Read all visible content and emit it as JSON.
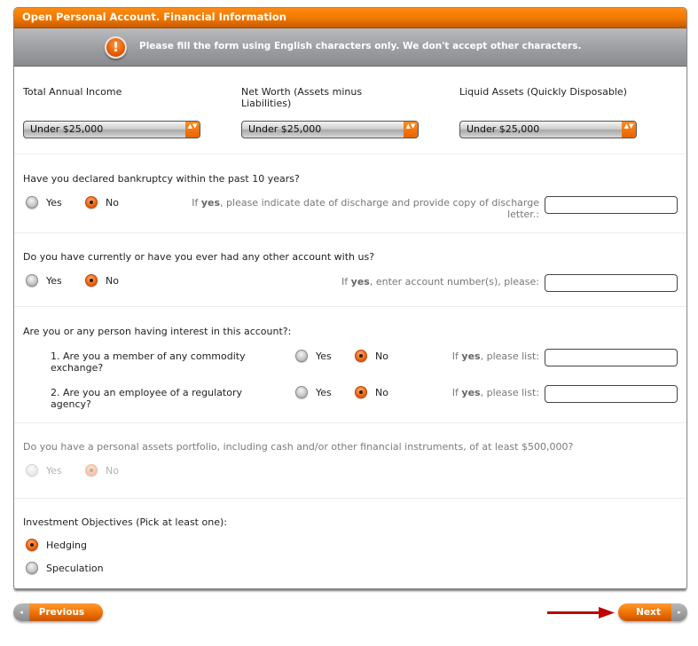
{
  "header": {
    "title": "Open Personal Account. Financial Information"
  },
  "notice": {
    "icon": "exclamation-icon",
    "icon_glyph": "!",
    "text": "Please fill the form using English characters only. We don't accept other characters."
  },
  "financials": {
    "total_annual_income": {
      "label": "Total Annual Income",
      "value": "Under $25,000"
    },
    "net_worth": {
      "label": "Net Worth (Assets minus Liabilities)",
      "value": "Under $25,000"
    },
    "liquid_assets": {
      "label": "Liquid Assets (Quickly Disposable)",
      "value": "Under $25,000"
    },
    "select_arrow_glyph": "▲▼"
  },
  "bankruptcy": {
    "question": "Have you declared bankruptcy within the past 10 years?",
    "options": [
      "Yes",
      "No"
    ],
    "selected": "No",
    "hint_prefix": "If ",
    "hint_bold": "yes",
    "hint_rest": ", please indicate date of discharge and provide copy of discharge letter.:",
    "input_value": ""
  },
  "other_account": {
    "question": "Do you have currently or have you ever had any other account with us?",
    "options": [
      "Yes",
      "No"
    ],
    "selected": "No",
    "hint_prefix": "If ",
    "hint_bold": "yes",
    "hint_rest": ", enter account number(s), please:",
    "input_value": ""
  },
  "interest": {
    "question": "Are you or any person having interest in this account?:",
    "items": [
      {
        "text": "1. Are you a member of any commodity exchange?",
        "options": [
          "Yes",
          "No"
        ],
        "selected": "No",
        "hint_prefix": "If ",
        "hint_bold": "yes",
        "hint_rest": ", please list:",
        "input_value": ""
      },
      {
        "text": "2. Are you an employee of a regulatory agency?",
        "options": [
          "Yes",
          "No"
        ],
        "selected": "No",
        "hint_prefix": "If ",
        "hint_bold": "yes",
        "hint_rest": ", please list:",
        "input_value": ""
      }
    ]
  },
  "portfolio": {
    "question": "Do you have a personal assets portfolio, including cash and/or other financial instruments, of at least $500,000?",
    "options": [
      "Yes",
      "No"
    ],
    "selected": "No",
    "disabled": true
  },
  "objectives": {
    "label": "Investment Objectives (Pick at least one):",
    "options": [
      "Hedging",
      "Speculation"
    ],
    "selected": "Hedging"
  },
  "nav": {
    "previous_label": "Previous",
    "previous_glyph": "◂",
    "next_label": "Next",
    "next_glyph": "▸"
  },
  "colors": {
    "accent": "#f07800",
    "notice_bg": "#9a9b9f",
    "indicator_arrow": "#c00000"
  }
}
